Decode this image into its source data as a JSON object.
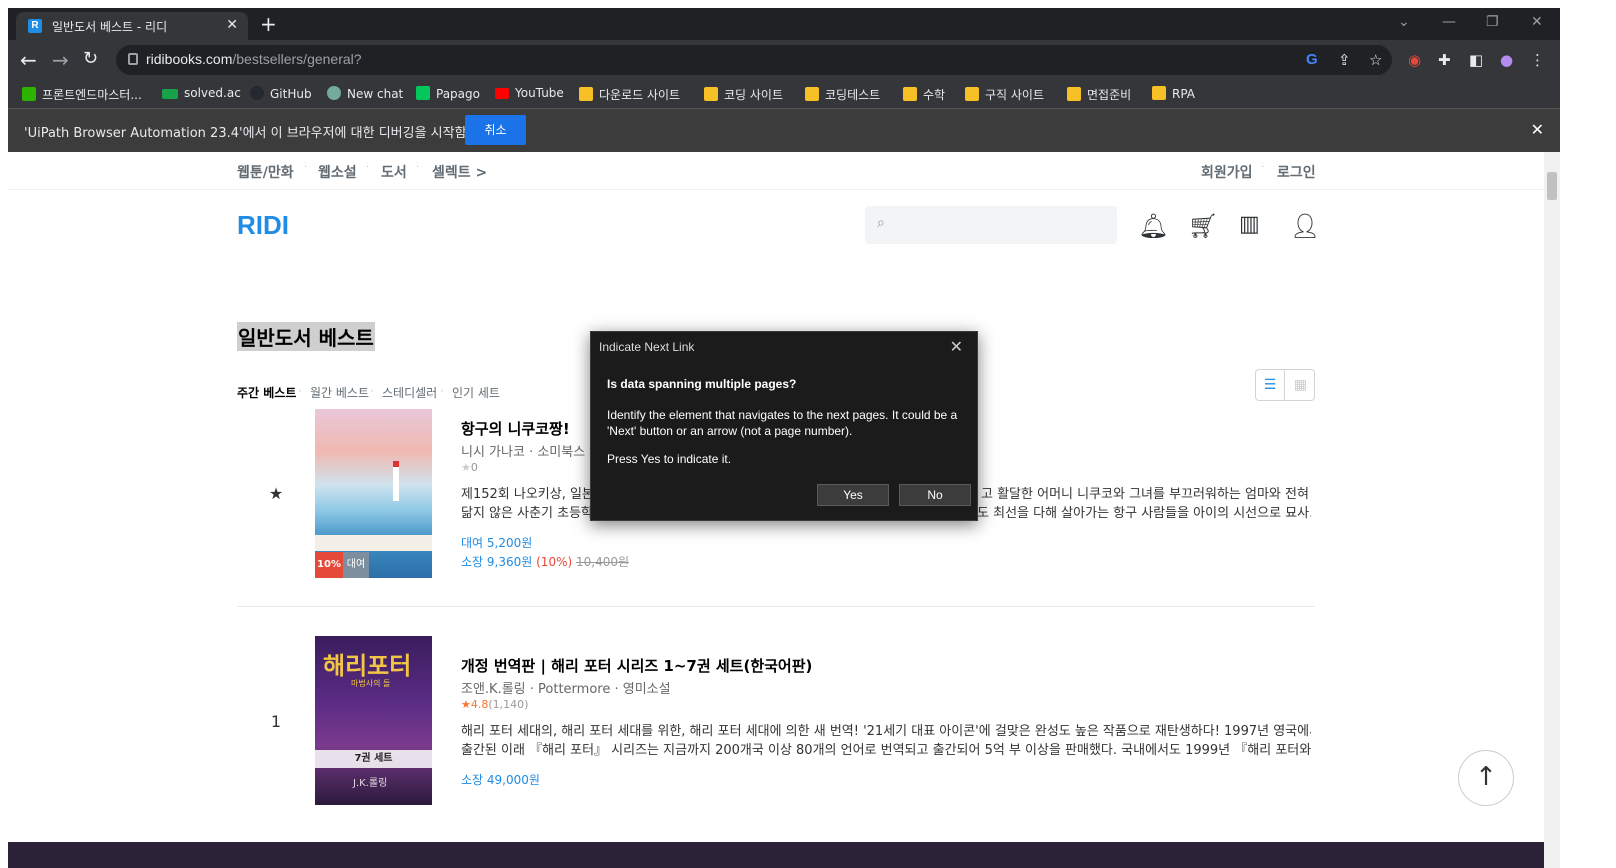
{
  "browser": {
    "tab_title": "일반도서 베스트 - 리디",
    "tab_favicon": "R",
    "new_tab": "+",
    "url_host": "ridibooks.com",
    "url_path": "/bestsellers/general?",
    "bookmarks": [
      {
        "label": "프론트엔드마스터...",
        "icon": "green"
      },
      {
        "label": "solved.ac",
        "icon": "green-ac"
      },
      {
        "label": "GitHub",
        "icon": "github"
      },
      {
        "label": "New chat",
        "icon": "openai"
      },
      {
        "label": "Papago",
        "icon": "papago"
      },
      {
        "label": "YouTube",
        "icon": "youtube"
      },
      {
        "label": "다운로드 사이트",
        "icon": "folder"
      },
      {
        "label": "코딩 사이트",
        "icon": "folder"
      },
      {
        "label": "코딩테스트",
        "icon": "folder"
      },
      {
        "label": "수학",
        "icon": "folder"
      },
      {
        "label": "구직 사이트",
        "icon": "folder"
      },
      {
        "label": "면접준비",
        "icon": "folder"
      },
      {
        "label": "RPA",
        "icon": "folder"
      }
    ],
    "debug_message": "'UiPath Browser Automation 23.4'에서 이 브라우저에 대한 디버깅을 시작함",
    "debug_cancel": "취소"
  },
  "site": {
    "gnb": [
      "웹툰/만화",
      "웹소설",
      "도서",
      "셀렉트 >"
    ],
    "auth": [
      "회원가입",
      "로그인"
    ],
    "logo": "RIDI",
    "page_title": "일반도서 베스트",
    "subtabs": [
      "주간 베스트",
      "월간 베스트",
      "스테디셀러",
      "인기 세트"
    ]
  },
  "books": [
    {
      "rank": "★",
      "title": "항구의 니쿠코짱!",
      "meta": "니시 가나코 · 소미북스",
      "rating": "0",
      "desc1": "제152회 나오키상, 일본",
      "desc1b": "고 활달한 어머니 니쿠코와 그녀를 부끄러워하는 엄마와 전혀",
      "desc2": "닮지 않은 사춘기 초등학생 기쿠코 사이의 비밀이 밝혀지며 벌어지는 이야기이다. 소다날지 불라도 최선을 다해 살아가는 항구 사람들을 아이의 시선으로 묘사...",
      "rent": "대여 5,200원",
      "own": "소장 9,360원",
      "disc": "(10%)",
      "orig": "10,400원",
      "badge_disc": "10%",
      "badge_rent": "대여"
    },
    {
      "rank": "1",
      "title": "개정 번역판 | 해리 포터 시리즈 1~7권 세트(한국어판)",
      "meta": "조앤.K.롤링 · Pottermore · 영미소설",
      "rating": "4.8",
      "rating_count": "(1,140)",
      "desc1": "해리 포터 세대의, 해리 포터 세대를 위한, 해리 포터 세대에 의한 새 번역! '21세기 대표 아이콘'에 걸맞은 완성도 높은 작품으로 재탄생하다! 1997년 영국에서",
      "desc2": "출간된 이래 『해리 포터』 시리즈는 지금까지 200개국 이상 80개의 언어로 번역되고 출간되어 5억 부 이상을 판매했다. 국내에서도 1999년 『해리 포터와...",
      "own": "소장 49,000원",
      "cover_title": "해리포터",
      "cover_sub": "마법사의 돌",
      "cover_set": "7권 세트",
      "cover_author": "J.K.롤링"
    }
  ],
  "dialog": {
    "title": "Indicate Next Link",
    "heading": "Is data spanning multiple pages?",
    "body": "Identify the element that navigates to the next pages. It could be a 'Next' button or an arrow (not a page number).",
    "press": "Press Yes to indicate it.",
    "yes": "Yes",
    "no": "No"
  },
  "colors": {
    "accent": "#1f8ce6",
    "discount": "#e64938",
    "rating": "#fa722e"
  }
}
